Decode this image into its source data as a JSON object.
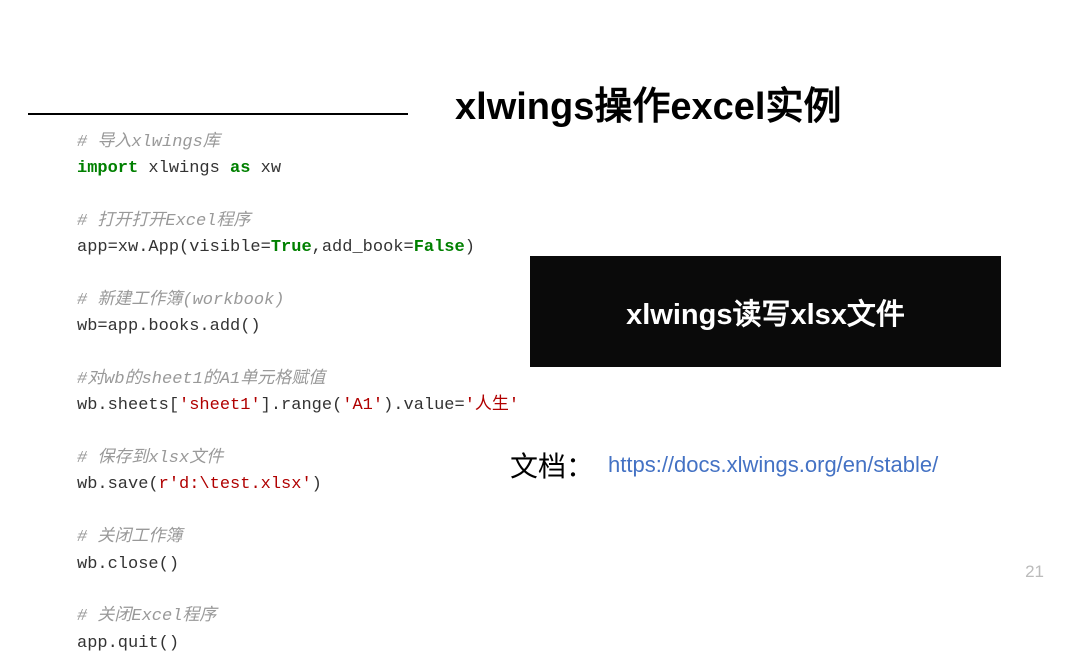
{
  "title": "xlwings操作excel实例",
  "code": {
    "c1": "# 导入xlwings库",
    "l1a": "import",
    "l1b": " xlwings ",
    "l1c": "as",
    "l1d": " xw",
    "c2": "# 打开打开Excel程序",
    "l2a": "app=xw.App(visible=",
    "l2b": "True",
    "l2c": ",add_book=",
    "l2d": "False",
    "l2e": ")",
    "c3": "# 新建工作簿(workbook)",
    "l3": "wb=app.books.add()",
    "c4": "#对wb的sheet1的A1单元格赋值",
    "l4a": "wb.sheets[",
    "l4b": "'sheet1'",
    "l4c": "].range(",
    "l4d": "'A1'",
    "l4e": ").value=",
    "l4f": "'人生'",
    "c5": "# 保存到xlsx文件",
    "l5a": "wb.save(",
    "l5b": "r'd:\\test.xlsx'",
    "l5c": ")",
    "c6": "# 关闭工作簿",
    "l6": "wb.close()",
    "c7": "# 关闭Excel程序",
    "l7": "app.quit()"
  },
  "banner": "xlwings读写xlsx文件",
  "doc_label": "文档：",
  "doc_url": "https://docs.xlwings.org/en/stable/",
  "page_number": "21"
}
